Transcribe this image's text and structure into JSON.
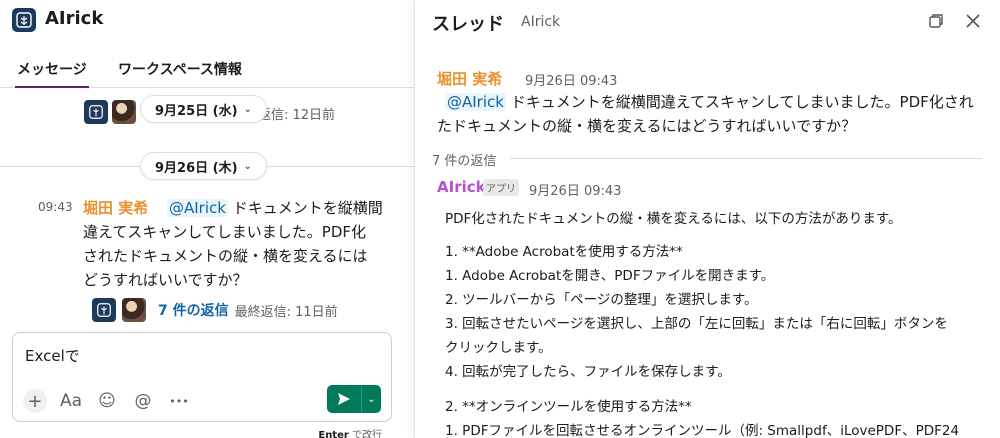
{
  "left": {
    "app_title": "AIrick",
    "tabs": [
      "メッセージ",
      "ワークスペース情報"
    ],
    "older_thread": {
      "reply_meta": "返信: 12日前"
    },
    "date_pills": [
      "9月25日 (水)",
      "9月26日 (木)"
    ],
    "message": {
      "time": "09:43",
      "author": "堀田 実希",
      "mention": "@AIrick",
      "text_line1": " ドキュメントを縦横間",
      "text_line2": "違えてスキャンしてしまいました。PDF化",
      "text_line3": "されたドキュメントの縦・横を変えるには",
      "text_line4": "どうすればいいですか？"
    },
    "reply_row": {
      "link": "7 件の返信",
      "last": "最終返信: 11日前"
    },
    "composer": {
      "value": "Excelで",
      "hint_key": "Enter",
      "hint_rest": " で改行"
    },
    "tools": {
      "plus": "+",
      "format": "Aa",
      "emoji": "☺",
      "mention": "@",
      "more": "•••"
    }
  },
  "right": {
    "title": "スレッド",
    "subtitle": "AIrick",
    "parent": {
      "author": "堀田 実希",
      "time": "9月26日 09:43",
      "mention": "@AIrick",
      "text_line1": " ドキュメントを縦横間違えてスキャンしてしまいました。PDF化され",
      "text_line2": "たドキュメントの縦・横を変えるにはどうすればいいですか？"
    },
    "replies_count": "7 件の返信",
    "reply": {
      "author": "AIrick",
      "badge": "アプリ",
      "time": "9月26日 09:43",
      "lines": [
        "PDF化されたドキュメントの縦・横を変えるには、以下の方法があります。",
        "1. **Adobe Acrobatを使用する方法**",
        "  1. Adobe Acrobatを開き、PDFファイルを開きます。",
        "  2. ツールバーから「ページの整理」を選択します。",
        "  3. 回転させたいページを選択し、上部の「左に回転」または「右に回転」ボタンを",
        "クリックします。",
        "  4. 回転が完了したら、ファイルを保存します。",
        "2. **オンラインツールを使用する方法**",
        "  1. PDFファイルを回転させるオンラインツール（例: Smallpdf、iLovePDF、PDF24"
      ]
    }
  },
  "colors": {
    "accent": "#611f69",
    "author": "#e8912d",
    "bot": "#b94fd6",
    "link": "#1264a3",
    "send": "#007a5a"
  }
}
